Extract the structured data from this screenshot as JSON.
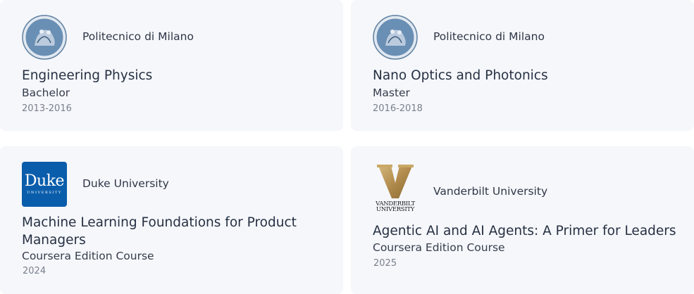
{
  "education": [
    {
      "institution": "Politecnico di Milano",
      "logo": "politecnico-seal-icon",
      "title": "Engineering Physics",
      "degree": "Bachelor",
      "years": "2013-2016"
    },
    {
      "institution": "Politecnico di Milano",
      "logo": "politecnico-seal-icon",
      "title": "Nano Optics and Photonics",
      "degree": "Master",
      "years": "2016-2018"
    },
    {
      "institution": "Duke University",
      "logo": "duke-logo",
      "logo_text": "Duke",
      "logo_subtext": "UNIVERSITY",
      "title": "Machine Learning Foundations for Product Managers",
      "degree": "Coursera Edition Course",
      "years": "2024"
    },
    {
      "institution": "Vanderbilt University",
      "logo": "vanderbilt-logo",
      "logo_text_1": "VANDERBILT",
      "logo_text_2": "UNIVERSITY",
      "title": "Agentic AI and AI Agents: A Primer for Leaders",
      "degree": "Coursera Edition Course",
      "years": "2025"
    }
  ],
  "colors": {
    "card_bg": "#f5f7fb",
    "duke_blue": "#0a5dab",
    "vanderbilt_gold": "#b8975a",
    "seal_blue": "#6a8fb4"
  }
}
